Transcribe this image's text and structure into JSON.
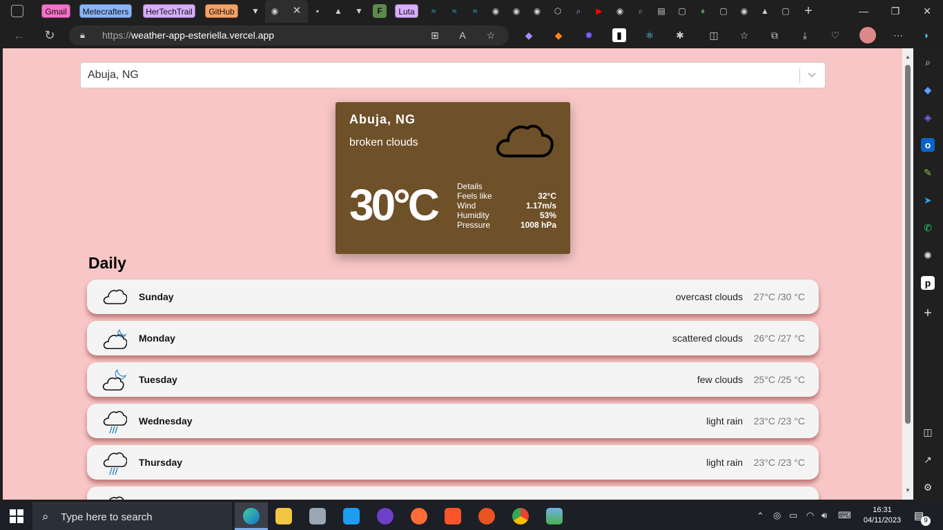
{
  "browser": {
    "tab_pills": [
      "Gmail",
      "Metecrafters",
      "HerTechTrail",
      "GitHub",
      "Luta"
    ],
    "url_scheme": "https://",
    "url_host": "weather-app-esteriella.vercel.app"
  },
  "app": {
    "location_select": {
      "value": "Abuja, NG"
    },
    "current": {
      "city": "Abuja, NG",
      "description": "broken clouds",
      "temperature": "30°C",
      "icon": "cloud-icon",
      "details_title": "Details",
      "details": [
        {
          "label": "Feels like",
          "value": "32°C"
        },
        {
          "label": "Wind",
          "value": "1.17m/s"
        },
        {
          "label": "Humidity",
          "value": "53%"
        },
        {
          "label": "Pressure",
          "value": "1008 hPa"
        }
      ]
    },
    "daily_title": "Daily",
    "daily": [
      {
        "day": "Sunday",
        "desc": "overcast clouds",
        "temp": "27°C /30 °C",
        "icon": "cloud-icon"
      },
      {
        "day": "Monday",
        "desc": "scattered clouds",
        "temp": "26°C /27 °C",
        "icon": "cloud-moon-icon"
      },
      {
        "day": "Tuesday",
        "desc": "few clouds",
        "temp": "25°C /25 °C",
        "icon": "cloud-moon-icon"
      },
      {
        "day": "Wednesday",
        "desc": "light rain",
        "temp": "23°C /23 °C",
        "icon": "cloud-rain-icon"
      },
      {
        "day": "Thursday",
        "desc": "light rain",
        "temp": "23°C /23 °C",
        "icon": "cloud-rain-icon"
      }
    ]
  },
  "taskbar": {
    "search_placeholder": "Type here to search",
    "time": "16:31",
    "date": "04/11/2023",
    "notification_count": "9"
  },
  "colors": {
    "page_bg": "#f8c6c6",
    "card_bg": "#6e5029",
    "row_bg": "#f4f4f4"
  }
}
